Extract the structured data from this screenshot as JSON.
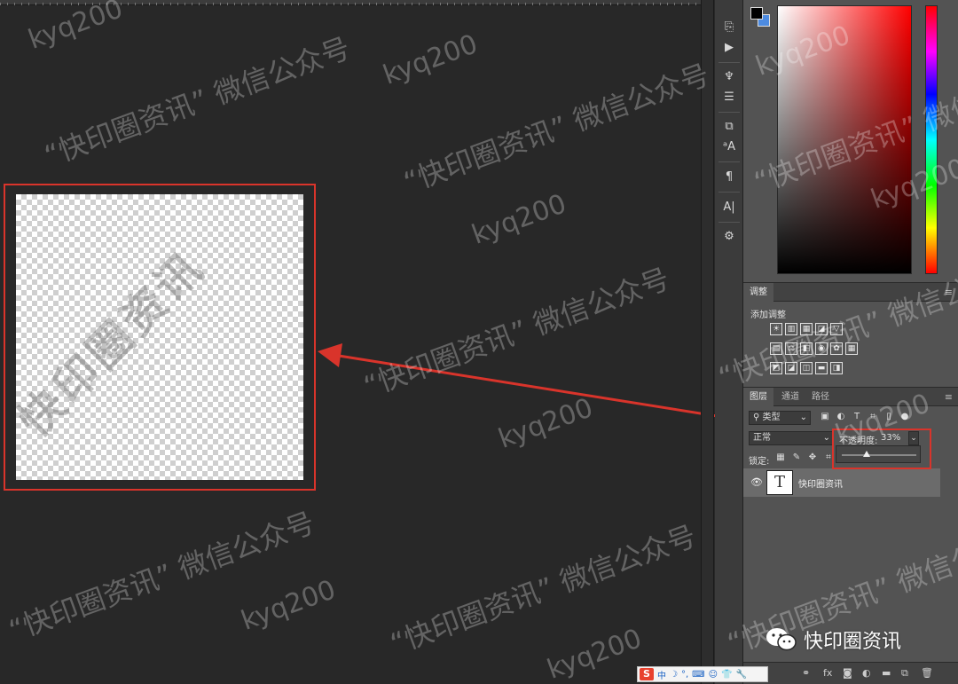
{
  "doc": {
    "layer_text": "快印圈资讯"
  },
  "tools": {
    "icons": [
      "history-brush-icon",
      "play-icon",
      "brush-settings-icon",
      "adjust-sliders-icon",
      "clone-source-icon",
      "character-style-icon",
      "paragraph-icon",
      "text-a-icon",
      "properties-icon"
    ]
  },
  "color_panel": {
    "foreground": "#000000",
    "background": "#4d8be0"
  },
  "adjust_panel": {
    "tab": "调整",
    "add_label": "添加调整"
  },
  "layers_panel": {
    "tabs": [
      "图层",
      "通道",
      "路径"
    ],
    "kind_filter": "类型",
    "blend_mode": "正常",
    "opacity_label": "不透明度:",
    "opacity_value": "33%",
    "opacity_fraction": 0.33,
    "lock_label": "锁定:",
    "layer": {
      "name": "快印圈资讯",
      "type_glyph": "T"
    }
  },
  "ime": {
    "logo": "S",
    "mode": "中"
  },
  "watermark": {
    "brand_en": "kyq200",
    "brand_cn": "“快印圈资讯” 微信公众号",
    "corner": "快印圈资讯"
  }
}
